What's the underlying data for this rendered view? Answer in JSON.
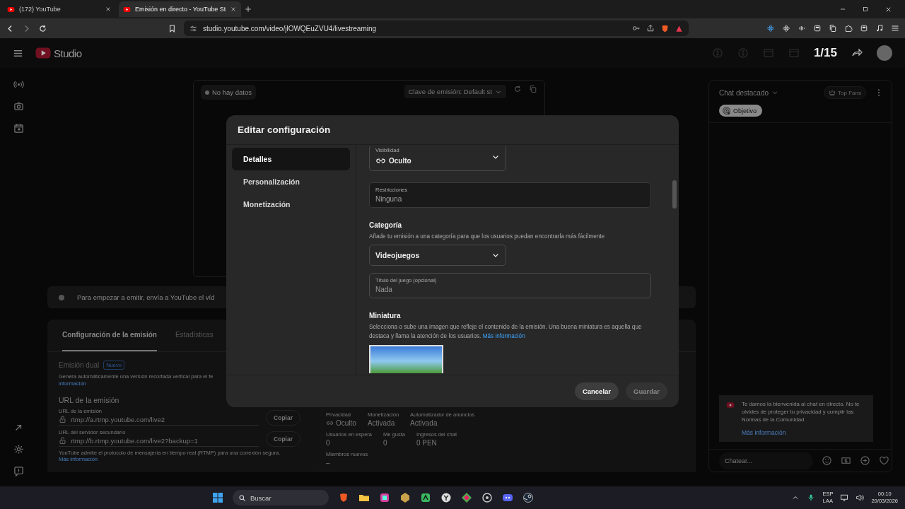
{
  "browser": {
    "tabs": [
      {
        "title": "(172) YouTube",
        "selected": false
      },
      {
        "title": "Emisión en directo - YouTube St",
        "selected": true
      }
    ],
    "url": "studio.youtube.com/video/jlOWQEuZVU4/livestreaming"
  },
  "header": {
    "logo": "Studio",
    "counter": "1/15"
  },
  "preview": {
    "status": "No hay datos",
    "stream_key": "Clave de emisión: Default st"
  },
  "banner": "Para empezar a emitir, envía a YouTube el víd",
  "settings": {
    "tabs": [
      {
        "label": "Configuración de la emisión",
        "selected": true
      },
      {
        "label": "Estadísticas",
        "selected": false
      }
    ],
    "dual": {
      "title": "Emisión dual",
      "badge": "Nuevo",
      "description": "Genera automáticamente una versión recortada vertical para el fe",
      "link": "información"
    },
    "url_heading": "URL de la emisión",
    "urls": [
      {
        "label": "URL de la emisión",
        "value": "rtmp://a.rtmp.youtube.com/live2",
        "button": "Copiar"
      },
      {
        "label": "URL del servidor secundario",
        "value": "rtmp://b.rtmp.youtube.com/live2?backup=1",
        "button": "Copiar"
      }
    ],
    "note": "YouTube admite el protocolo de mensajería en tiempo real (RTMP) para una conexión segura.",
    "note_link": "Más información"
  },
  "stats": [
    [
      {
        "label": "Privacidad",
        "value": "Oculto",
        "kind": "privacy"
      },
      {
        "label": "Monetización",
        "value": "Activada",
        "kind": "plain"
      },
      {
        "label": "Automatizador de anuncios",
        "value": "Activada",
        "kind": "plain"
      }
    ],
    [
      {
        "label": "Usuarios en espera",
        "value": "0",
        "kind": "plain"
      },
      {
        "label": "Me gusta",
        "value": "0",
        "kind": "plain"
      },
      {
        "label": "Ingresos del chat",
        "value": "0 PEN",
        "kind": "plain"
      }
    ],
    [
      {
        "label": "Miembros nuevos",
        "value": "–",
        "kind": "plain"
      }
    ]
  ],
  "chat": {
    "title": "Chat destacado",
    "top_fans": "Top Fans",
    "goal": "Objetivo",
    "welcome": "Te damos la bienvenida al chat en directo. No te olvides de proteger tu privacidad y cumplir las Normas de la Comunidad.",
    "welcome_link": "Más información",
    "placeholder": "Chatear..."
  },
  "modal": {
    "title": "Editar configuración",
    "nav": [
      {
        "label": "Detalles",
        "selected": true
      },
      {
        "label": "Personalización",
        "selected": false
      },
      {
        "label": "Monetización",
        "selected": false
      }
    ],
    "visibility": {
      "label": "Visibilidad",
      "value": "Oculto"
    },
    "restrictions": {
      "label": "Restricciones",
      "value": "Ninguna"
    },
    "category": {
      "heading": "Categoría",
      "description": "Añade tu emisión a una categoría para que los usuarios puedan encontrarla más fácilmente",
      "value": "Videojuegos"
    },
    "game_title": {
      "label": "Título del juego (opcional)",
      "placeholder": "Nada"
    },
    "thumbnail": {
      "heading": "Miniatura",
      "description": "Selecciona o sube una imagen que refleje el contenido de la emisión. Una buena miniatura es aquella que destaca y llama la atención de los usuarios.",
      "link": "Más información"
    },
    "buttons": [
      {
        "label": "Cancelar",
        "disabled": false
      },
      {
        "label": "Guardar",
        "disabled": true
      }
    ]
  },
  "taskbar": {
    "search_placeholder": "Buscar",
    "language": "ESP",
    "layout": "LAA",
    "time": "00:10",
    "date": "20/03/2026"
  }
}
